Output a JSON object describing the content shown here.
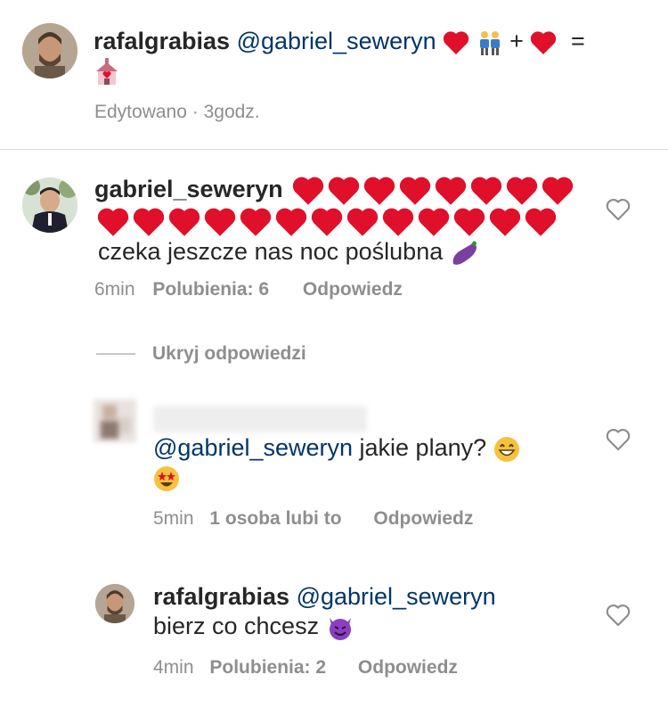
{
  "caption": {
    "username": "rafalgrabias",
    "mention": "@gabriel_seweryn",
    "plus": "+",
    "equals": "=",
    "edited_label": "Edytowano",
    "dot": "·",
    "time": "3godz."
  },
  "comments": [
    {
      "username": "gabriel_seweryn",
      "text": "czeka jeszcze nas noc poślubna",
      "time": "6min",
      "likes": "Polubienia: 6",
      "reply": "Odpowiedz"
    }
  ],
  "hide_replies": "Ukryj odpowiedzi",
  "replies": [
    {
      "mention": "@gabriel_seweryn",
      "text": "jakie plany?",
      "time": "5min",
      "likes": "1 osoba lubi to",
      "reply": "Odpowiedz"
    },
    {
      "username": "rafalgrabias",
      "mention": "@gabriel_seweryn",
      "text": "bierz co chcesz",
      "time": "4min",
      "likes": "Polubienia: 2",
      "reply": "Odpowiedz"
    }
  ],
  "colors": {
    "heart": "#e0102a",
    "mention": "#003569",
    "meta": "#8e8e8e",
    "divider": "#dbdbdb"
  }
}
